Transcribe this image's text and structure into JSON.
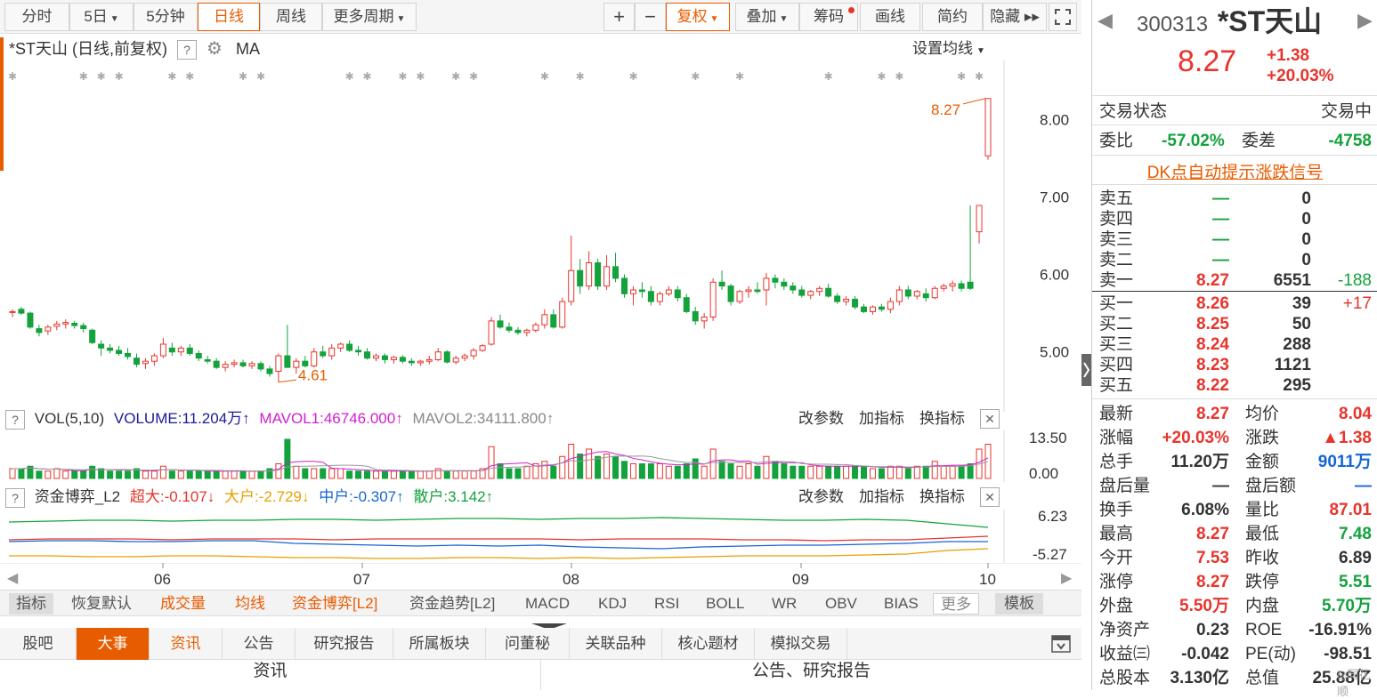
{
  "toolbar": {
    "items": [
      "分时",
      "5日",
      "5分钟",
      "日线",
      "周线",
      "更多周期"
    ],
    "right": [
      "+",
      "−",
      "复权",
      "叠加",
      "筹码",
      "画线",
      "简约",
      "隐藏 ▸▸"
    ],
    "active": "日线"
  },
  "chart": {
    "title": "*ST天山 (日线,前复权)",
    "ma": "MA",
    "settings": "设置均线",
    "price_ticks": [
      "8.00",
      "7.00",
      "6.00",
      "5.00"
    ],
    "max_label": "8.27",
    "min_label": "4.61",
    "months": [
      "06",
      "07",
      "08",
      "09",
      "10"
    ]
  },
  "chart_data": {
    "type": "candlestick",
    "y_range": [
      4.4,
      8.6
    ],
    "ohlc": [
      [
        5.52,
        5.55,
        5.45,
        5.52
      ],
      [
        5.55,
        5.58,
        5.48,
        5.5
      ],
      [
        5.5,
        5.52,
        5.3,
        5.32
      ],
      [
        5.3,
        5.35,
        5.2,
        5.25
      ],
      [
        5.27,
        5.35,
        5.22,
        5.32
      ],
      [
        5.33,
        5.4,
        5.28,
        5.36
      ],
      [
        5.36,
        5.42,
        5.3,
        5.38
      ],
      [
        5.37,
        5.4,
        5.3,
        5.34
      ],
      [
        5.34,
        5.38,
        5.25,
        5.3
      ],
      [
        5.28,
        5.3,
        5.1,
        5.12
      ],
      [
        5.1,
        5.15,
        4.95,
        5.05
      ],
      [
        5.05,
        5.1,
        4.98,
        5.02
      ],
      [
        5.02,
        5.08,
        4.95,
        4.98
      ],
      [
        4.98,
        5.05,
        4.9,
        4.94
      ],
      [
        4.92,
        4.98,
        4.8,
        4.84
      ],
      [
        4.85,
        4.92,
        4.78,
        4.88
      ],
      [
        4.88,
        4.98,
        4.82,
        4.95
      ],
      [
        4.95,
        5.18,
        4.92,
        5.1
      ],
      [
        5.05,
        5.12,
        4.95,
        5.0
      ],
      [
        5.0,
        5.08,
        4.95,
        5.05
      ],
      [
        5.05,
        5.1,
        4.95,
        4.98
      ],
      [
        4.98,
        5.02,
        4.88,
        4.92
      ],
      [
        4.9,
        4.95,
        4.85,
        4.88
      ],
      [
        4.88,
        4.92,
        4.78,
        4.8
      ],
      [
        4.8,
        4.88,
        4.75,
        4.84
      ],
      [
        4.84,
        4.9,
        4.8,
        4.86
      ],
      [
        4.86,
        4.9,
        4.8,
        4.82
      ],
      [
        4.82,
        4.88,
        4.78,
        4.85
      ],
      [
        4.85,
        4.88,
        4.75,
        4.78
      ],
      [
        4.78,
        4.82,
        4.68,
        4.72
      ],
      [
        4.75,
        4.98,
        4.61,
        4.95
      ],
      [
        4.95,
        5.35,
        4.9,
        4.8
      ],
      [
        4.8,
        4.92,
        4.72,
        4.88
      ],
      [
        4.88,
        4.95,
        4.8,
        4.82
      ],
      [
        4.82,
        5.05,
        4.8,
        5.0
      ],
      [
        5.0,
        5.08,
        4.92,
        4.95
      ],
      [
        4.95,
        5.1,
        4.9,
        5.05
      ],
      [
        5.05,
        5.12,
        5.0,
        5.1
      ],
      [
        5.1,
        5.15,
        5.0,
        5.02
      ],
      [
        5.02,
        5.08,
        4.95,
        5.0
      ],
      [
        5.0,
        5.05,
        4.9,
        4.92
      ],
      [
        4.92,
        4.98,
        4.88,
        4.95
      ],
      [
        4.95,
        4.98,
        4.85,
        4.9
      ],
      [
        4.9,
        4.95,
        4.85,
        4.93
      ],
      [
        4.93,
        4.96,
        4.85,
        4.88
      ],
      [
        4.88,
        4.92,
        4.82,
        4.86
      ],
      [
        4.86,
        4.9,
        4.82,
        4.88
      ],
      [
        4.88,
        4.95,
        4.84,
        4.9
      ],
      [
        4.9,
        5.05,
        4.88,
        5.0
      ],
      [
        5.0,
        5.02,
        4.85,
        4.87
      ],
      [
        4.87,
        4.95,
        4.84,
        4.92
      ],
      [
        4.92,
        4.98,
        4.88,
        4.95
      ],
      [
        4.95,
        5.05,
        4.9,
        5.02
      ],
      [
        5.02,
        5.1,
        5.0,
        5.08
      ],
      [
        5.1,
        5.45,
        5.08,
        5.4
      ],
      [
        5.4,
        5.48,
        5.3,
        5.32
      ],
      [
        5.32,
        5.38,
        5.25,
        5.28
      ],
      [
        5.28,
        5.32,
        5.22,
        5.25
      ],
      [
        5.25,
        5.3,
        5.2,
        5.28
      ],
      [
        5.28,
        5.38,
        5.25,
        5.35
      ],
      [
        5.35,
        5.55,
        5.3,
        5.48
      ],
      [
        5.48,
        5.55,
        5.3,
        5.32
      ],
      [
        5.32,
        5.7,
        5.3,
        5.65
      ],
      [
        5.65,
        6.5,
        5.6,
        6.05
      ],
      [
        6.05,
        6.2,
        5.75,
        5.85
      ],
      [
        5.85,
        6.3,
        5.8,
        6.15
      ],
      [
        6.15,
        6.2,
        5.8,
        5.85
      ],
      [
        5.85,
        6.25,
        5.8,
        6.1
      ],
      [
        6.1,
        6.28,
        5.9,
        5.95
      ],
      [
        5.95,
        6.0,
        5.7,
        5.75
      ],
      [
        5.75,
        5.85,
        5.6,
        5.8
      ],
      [
        5.8,
        5.9,
        5.7,
        5.78
      ],
      [
        5.78,
        5.85,
        5.6,
        5.65
      ],
      [
        5.65,
        5.78,
        5.6,
        5.75
      ],
      [
        5.75,
        5.85,
        5.72,
        5.8
      ],
      [
        5.8,
        5.85,
        5.65,
        5.7
      ],
      [
        5.7,
        5.75,
        5.5,
        5.52
      ],
      [
        5.52,
        5.58,
        5.35,
        5.4
      ],
      [
        5.4,
        5.5,
        5.3,
        5.45
      ],
      [
        5.45,
        5.95,
        5.4,
        5.9
      ],
      [
        5.9,
        6.05,
        5.8,
        5.85
      ],
      [
        5.85,
        5.88,
        5.6,
        5.65
      ],
      [
        5.65,
        5.8,
        5.62,
        5.78
      ],
      [
        5.78,
        5.85,
        5.7,
        5.8
      ],
      [
        5.8,
        5.9,
        5.75,
        5.78
      ],
      [
        5.8,
        6.02,
        5.6,
        5.95
      ],
      [
        5.95,
        6.0,
        5.82,
        5.9
      ],
      [
        5.9,
        5.95,
        5.8,
        5.85
      ],
      [
        5.85,
        5.9,
        5.75,
        5.8
      ],
      [
        5.8,
        5.85,
        5.7,
        5.73
      ],
      [
        5.73,
        5.8,
        5.68,
        5.78
      ],
      [
        5.78,
        5.85,
        5.72,
        5.82
      ],
      [
        5.82,
        5.88,
        5.7,
        5.72
      ],
      [
        5.72,
        5.76,
        5.62,
        5.65
      ],
      [
        5.65,
        5.72,
        5.6,
        5.68
      ],
      [
        5.68,
        5.72,
        5.55,
        5.58
      ],
      [
        5.58,
        5.62,
        5.5,
        5.52
      ],
      [
        5.52,
        5.6,
        5.48,
        5.58
      ],
      [
        5.58,
        5.62,
        5.52,
        5.55
      ],
      [
        5.55,
        5.7,
        5.5,
        5.65
      ],
      [
        5.65,
        5.85,
        5.6,
        5.8
      ],
      [
        5.8,
        5.85,
        5.68,
        5.72
      ],
      [
        5.72,
        5.8,
        5.68,
        5.78
      ],
      [
        5.75,
        5.82,
        5.65,
        5.7
      ],
      [
        5.7,
        5.85,
        5.68,
        5.82
      ],
      [
        5.82,
        5.88,
        5.78,
        5.85
      ],
      [
        5.85,
        5.92,
        5.78,
        5.88
      ],
      [
        5.88,
        5.92,
        5.78,
        5.82
      ],
      [
        5.9,
        6.89,
        5.8,
        5.82
      ],
      [
        6.55,
        6.89,
        6.4,
        6.89
      ],
      [
        7.53,
        8.27,
        7.48,
        8.27
      ]
    ],
    "volume_axis": [
      "13.50",
      "0.00"
    ],
    "vol_values": [
      4,
      4,
      5,
      3,
      3,
      4,
      3,
      3,
      3,
      5,
      4,
      3,
      3,
      3,
      4,
      3,
      3,
      5,
      3,
      3,
      3,
      3,
      3,
      3,
      3,
      3,
      3,
      3,
      3,
      4,
      6,
      16,
      5,
      4,
      4,
      4,
      4,
      4,
      3,
      3,
      3,
      3,
      3,
      3,
      3,
      3,
      3,
      3,
      4,
      3,
      3,
      3,
      3,
      4,
      13,
      6,
      4,
      4,
      5,
      6,
      7,
      5,
      9,
      14,
      10,
      12,
      9,
      10,
      9,
      7,
      6,
      6,
      6,
      6,
      5,
      5,
      6,
      8,
      5,
      12,
      7,
      6,
      5,
      6,
      5,
      9,
      7,
      6,
      5,
      5,
      5,
      5,
      5,
      5,
      5,
      5,
      5,
      4,
      4,
      5,
      5,
      4,
      5,
      5,
      7,
      5,
      5,
      5,
      6,
      12,
      14
    ],
    "vol_up": [
      1,
      0,
      0,
      0,
      1,
      1,
      1,
      0,
      0,
      0,
      0,
      0,
      0,
      0,
      0,
      1,
      1,
      1,
      0,
      1,
      0,
      0,
      0,
      0,
      1,
      1,
      0,
      1,
      0,
      0,
      1,
      0,
      1,
      0,
      1,
      0,
      1,
      1,
      0,
      0,
      0,
      1,
      0,
      1,
      0,
      0,
      1,
      1,
      1,
      0,
      1,
      1,
      1,
      1,
      1,
      0,
      0,
      0,
      1,
      1,
      1,
      0,
      1,
      1,
      0,
      1,
      0,
      1,
      0,
      0,
      1,
      0,
      0,
      1,
      1,
      0,
      0,
      0,
      1,
      1,
      0,
      0,
      1,
      1,
      0,
      1,
      0,
      0,
      0,
      0,
      1,
      1,
      0,
      0,
      1,
      0,
      0,
      1,
      0,
      1,
      1,
      0,
      1,
      0,
      1,
      1,
      1,
      0,
      0,
      1,
      1
    ],
    "fund_axis": [
      "6.23",
      "-5.27"
    ],
    "xlabel_months": [
      "06",
      "07",
      "08",
      "09",
      "10"
    ]
  },
  "vol_header": {
    "name": "VOL(5,10)",
    "volume": "VOLUME:11.204万",
    "mavol1": "MAVOL1:46746.000",
    "mavol2": "MAVOL2:34111.800",
    "btns": [
      "改参数",
      "加指标",
      "换指标"
    ]
  },
  "fund_header": {
    "name": "资金博弈_L2",
    "c1": "超大:-0.107",
    "c2": "大户:-2.729",
    "c3": "中户:-0.307",
    "c4": "散户:3.142",
    "btns": [
      "改参数",
      "加指标",
      "换指标"
    ]
  },
  "indicator_tabs": [
    "指标",
    "恢复默认",
    "成交量",
    "均线",
    "资金博弈[L2]",
    "资金趋势[L2]",
    "MACD",
    "KDJ",
    "RSI",
    "BOLL",
    "WR",
    "OBV",
    "BIAS",
    "更多",
    "模板"
  ],
  "news_tabs": [
    "股吧",
    "大事",
    "资讯",
    "公告",
    "研究报告",
    "所属板块",
    "问董秘",
    "关联品种",
    "核心题材",
    "模拟交易"
  ],
  "bottom": {
    "left": "资讯",
    "right": "公告、研究报告"
  },
  "quote": {
    "code": "300313",
    "name": "*ST天山",
    "price": "8.27",
    "change": "+1.38",
    "pct": "+20.03%",
    "status_label": "交易状态",
    "status": "交易中",
    "weibi_label": "委比",
    "weibi": "-57.02%",
    "weicha_label": "委差",
    "weicha": "-4758",
    "dk": "DK点自动提示涨跌信号",
    "sells": [
      {
        "l": "卖五",
        "p": "—",
        "v": "0",
        "d": ""
      },
      {
        "l": "卖四",
        "p": "—",
        "v": "0",
        "d": ""
      },
      {
        "l": "卖三",
        "p": "—",
        "v": "0",
        "d": ""
      },
      {
        "l": "卖二",
        "p": "—",
        "v": "0",
        "d": ""
      },
      {
        "l": "卖一",
        "p": "8.27",
        "v": "6551",
        "d": "-188"
      }
    ],
    "buys": [
      {
        "l": "买一",
        "p": "8.26",
        "v": "39",
        "d": "+17"
      },
      {
        "l": "买二",
        "p": "8.25",
        "v": "50",
        "d": ""
      },
      {
        "l": "买三",
        "p": "8.24",
        "v": "288",
        "d": ""
      },
      {
        "l": "买四",
        "p": "8.23",
        "v": "1121",
        "d": ""
      },
      {
        "l": "买五",
        "p": "8.22",
        "v": "295",
        "d": ""
      }
    ],
    "stats": [
      [
        "最新",
        "8.27",
        "均价",
        "8.04"
      ],
      [
        "涨幅",
        "+20.03%",
        "涨跌",
        "▲1.38"
      ],
      [
        "总手",
        "11.20万",
        "金额",
        "9011万"
      ],
      [
        "盘后量",
        "—",
        "盘后额",
        "—"
      ],
      [
        "换手",
        "6.08%",
        "量比",
        "87.01"
      ],
      [
        "最高",
        "8.27",
        "最低",
        "7.48"
      ],
      [
        "今开",
        "7.53",
        "昨收",
        "6.89"
      ],
      [
        "涨停",
        "8.27",
        "跌停",
        "5.51"
      ],
      [
        "外盘",
        "5.50万",
        "内盘",
        "5.70万"
      ],
      [
        "净资产",
        "0.23",
        "ROE",
        "-16.91%"
      ],
      [
        "收益㈢",
        "-0.042",
        "PE(动)",
        "-98.51"
      ],
      [
        "总股本",
        "3.130亿",
        "总值",
        "25.88亿"
      ]
    ],
    "stat_colors": [
      [
        "red",
        "red"
      ],
      [
        "red",
        "red"
      ],
      [
        "dark",
        "blue"
      ],
      [
        "dark",
        "blue"
      ],
      [
        "dark",
        "red"
      ],
      [
        "red",
        "green"
      ],
      [
        "red",
        "dark"
      ],
      [
        "red",
        "green"
      ],
      [
        "red",
        "green"
      ],
      [
        "dark",
        "dark"
      ],
      [
        "dark",
        "dark"
      ],
      [
        "dark",
        "dark"
      ]
    ],
    "colors": {
      "up": "#e8342c",
      "down": "#13a23c",
      "accent": "#e85c00"
    }
  }
}
